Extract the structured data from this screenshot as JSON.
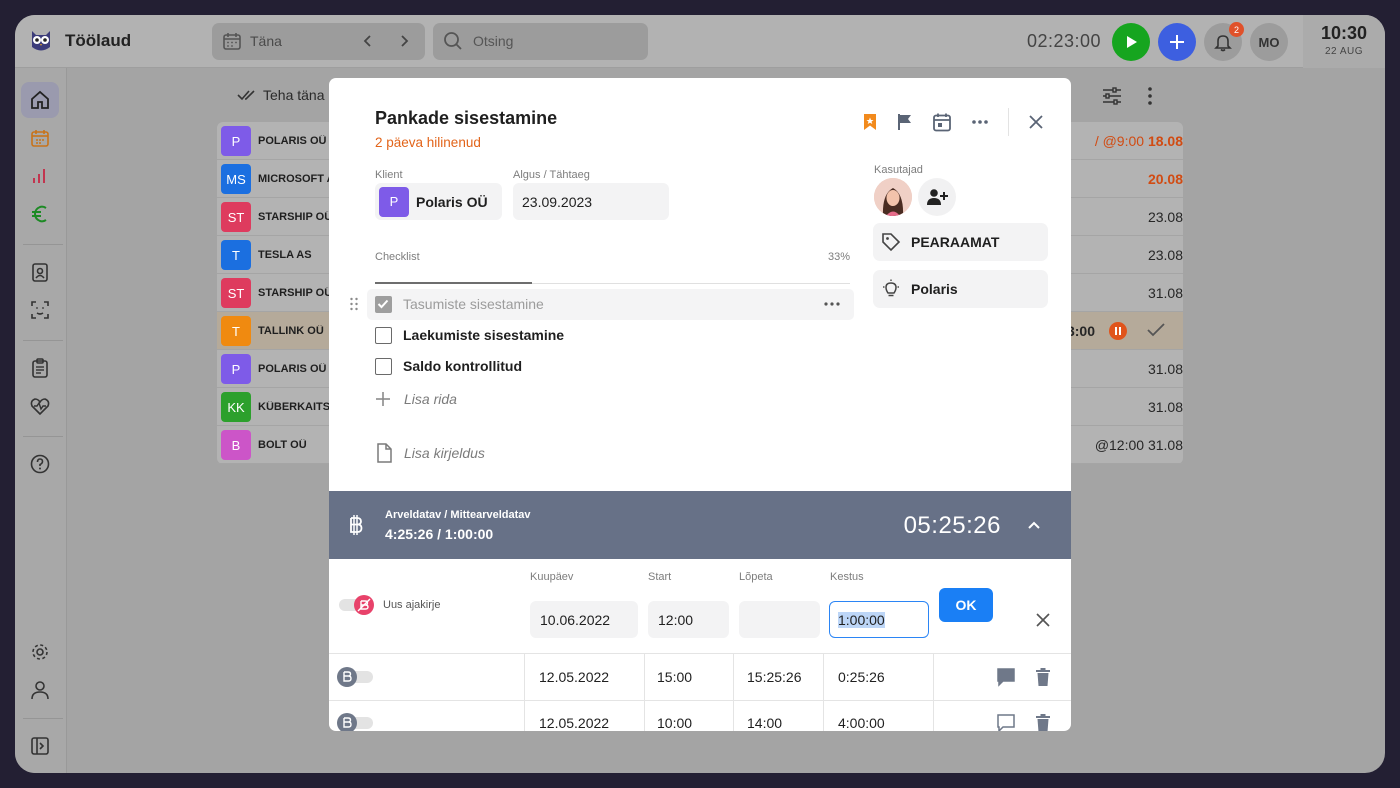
{
  "header": {
    "app_title": "Töölaud",
    "date_label": "Täna",
    "search_placeholder": "Otsing",
    "timer": "02:23:00",
    "notification_count": "2",
    "avatar_initials": "MO",
    "clock_time": "10:30",
    "clock_date": "22 AUG"
  },
  "toolbar": {
    "teha_label": "Teha täna"
  },
  "background_rows": [
    {
      "initials": "P",
      "color": "#7e5be8",
      "name": "POLARIS OÜ",
      "due_prefix": "/ @9:00",
      "due": "18.08",
      "due_color": "#d14b12"
    },
    {
      "initials": "MS",
      "color": "#1b6fe0",
      "name": "MICROSOFT A",
      "due_prefix": "",
      "due": "20.08",
      "due_color": "#d14b12"
    },
    {
      "initials": "ST",
      "color": "#de3b5e",
      "name": "STARSHIP OÜ",
      "due_prefix": "",
      "due": "23.08",
      "due_color": "#262626"
    },
    {
      "initials": "T",
      "color": "#1b6fe0",
      "name": "TESLA AS",
      "due_prefix": "",
      "due": "23.08",
      "due_color": "#262626"
    },
    {
      "initials": "ST",
      "color": "#de3b5e",
      "name": "STARSHIP OÜ",
      "due_prefix": "",
      "due": "31.08",
      "due_color": "#262626"
    },
    {
      "initials": "T",
      "color": "#f08a10",
      "name": "TALLINK OÜ",
      "due_prefix": "",
      "due": "3:00",
      "due_color": "#262626"
    },
    {
      "initials": "P",
      "color": "#7e5be8",
      "name": "POLARIS OÜ",
      "due_prefix": "",
      "due": "31.08",
      "due_color": "#262626"
    },
    {
      "initials": "KK",
      "color": "#2ca02c",
      "name": "KÜBERKAITSE",
      "due_prefix": "",
      "due": "31.08",
      "due_color": "#262626"
    },
    {
      "initials": "B",
      "color": "#cc55c8",
      "name": "BOLT OÜ",
      "due_prefix": "@12:00",
      "due": "31.08",
      "due_color": "#262626"
    }
  ],
  "modal": {
    "title": "Pankade sisestamine",
    "subtitle": "2 päeva hilinenud",
    "client_label": "Klient",
    "client_initials": "P",
    "client_name": "Polaris OÜ",
    "date_label": "Algus / Tähtaeg",
    "date_value": "23.09.2023",
    "checklist_label": "Checklist",
    "checklist_progress": "33%",
    "checklist_progress_fraction": 0.33,
    "checklist": [
      {
        "label": "Tasumiste sisestamine",
        "checked": true
      },
      {
        "label": "Laekumiste sisestamine",
        "checked": false
      },
      {
        "label": "Saldo kontrollitud",
        "checked": false
      }
    ],
    "add_row": "Lisa rida",
    "add_description": "Lisa kirjeldus",
    "users_label": "Kasutajad",
    "tag": "PEARAAMAT",
    "project": "Polaris"
  },
  "time": {
    "label": "Arveldatav / Mittearveldatav",
    "values": "4:25:26 / 1:00:00",
    "total": "05:25:26",
    "editor": {
      "toggle_label": "Uus ajakirje",
      "date_label": "Kuupäev",
      "date": "10.06.2022",
      "start_label": "Start",
      "start": "12:00",
      "end_label": "Lõpeta",
      "end": "",
      "duration_label": "Kestus",
      "duration": "1:00:00",
      "ok": "OK"
    },
    "entries": [
      {
        "date": "12.05.2022",
        "start": "15:00",
        "end": "15:25:26",
        "duration": "0:25:26"
      },
      {
        "date": "12.05.2022",
        "start": "10:00",
        "end": "14:00",
        "duration": "4:00:00"
      }
    ]
  }
}
